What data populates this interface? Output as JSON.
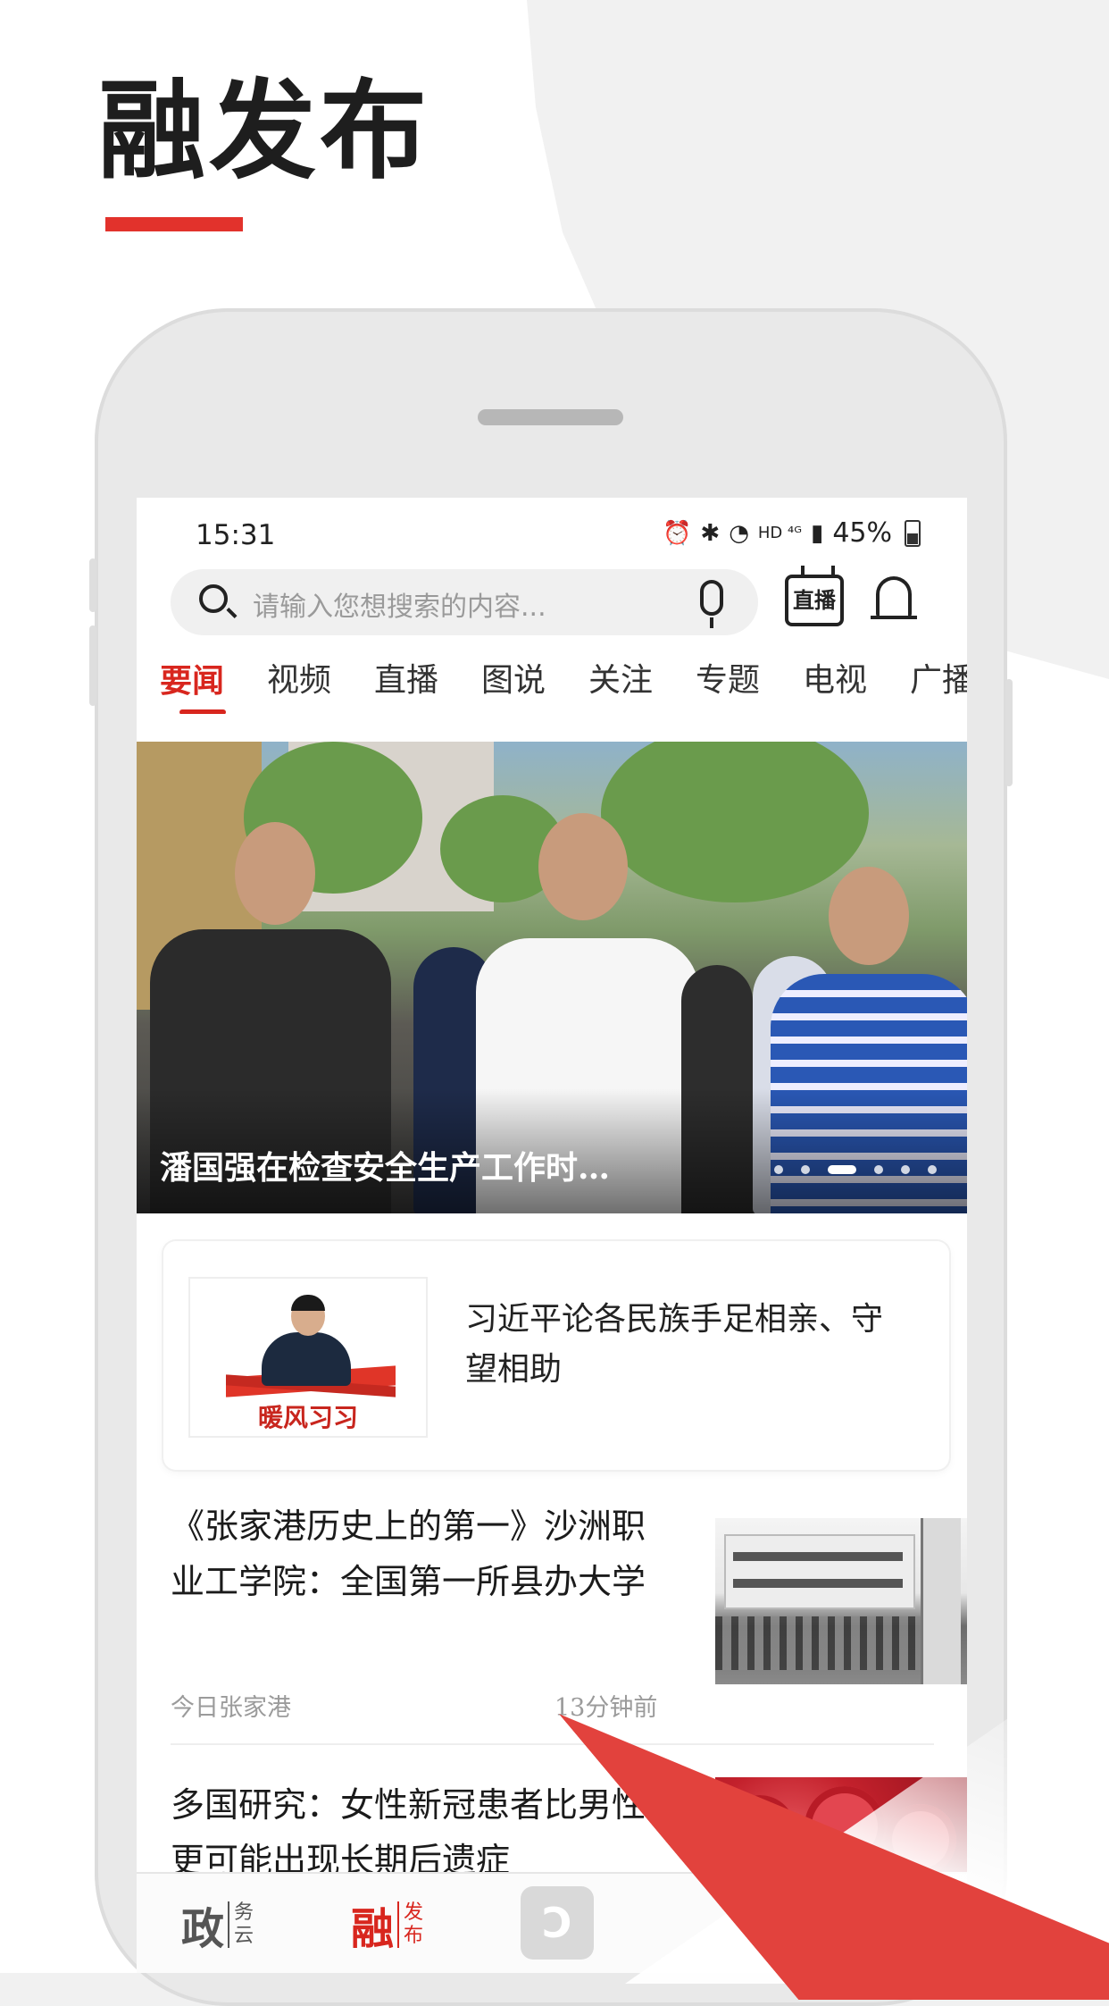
{
  "promo": {
    "title": "融发布"
  },
  "status": {
    "time": "15:31",
    "network": "HD ⁴ᴳ",
    "battery": "45%"
  },
  "search": {
    "placeholder": "请输入您想搜索的内容..."
  },
  "header": {
    "live_label": "直播"
  },
  "tabs": [
    "要闻",
    "视频",
    "直播",
    "图说",
    "关注",
    "专题",
    "电视",
    "广播"
  ],
  "banner": {
    "caption": "潘国强在检查安全生产工作时…",
    "slide_count": 6,
    "active_slide": 3
  },
  "feature": {
    "thumb_label": "暖风习习",
    "title": "习近平论各民族手足相亲、守望相助"
  },
  "news": [
    {
      "title": "《张家港历史上的第一》沙洲职业工学院：全国第一所县办大学",
      "source": "今日张家港",
      "time": "13分钟前"
    },
    {
      "title": "多国研究：女性新冠患者比男性更可能出现长期后遗症"
    }
  ],
  "bottom_nav": [
    {
      "big": "政",
      "small1": "务",
      "small2": "云",
      "color": "#555555"
    },
    {
      "big": "融",
      "small1": "发",
      "small2": "布",
      "color": "#d8261e"
    }
  ],
  "colors": {
    "accent": "#d8261e",
    "promo_underline": "#e2322c"
  }
}
